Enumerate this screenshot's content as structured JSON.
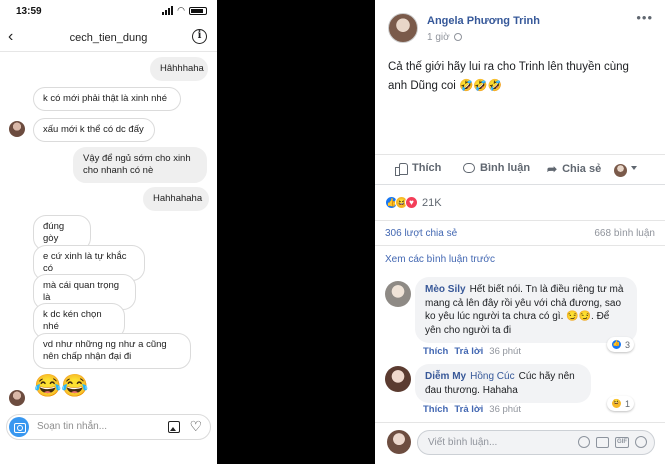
{
  "instagram": {
    "status_time": "13:59",
    "username": "cech_tien_dung",
    "messages": [
      {
        "from": "me",
        "text": "Hâhhhaha"
      },
      {
        "from": "them",
        "text": "k có mới phải thật là xinh nhé"
      },
      {
        "from": "them",
        "text": "xấu mới k thể có dc đấy"
      },
      {
        "from": "me",
        "text": "Vậy để ngủ sớm cho xinh cho nhanh có nè"
      },
      {
        "from": "me",
        "text": "Hahhahaha"
      },
      {
        "from": "them",
        "text": "đúng gòy"
      },
      {
        "from": "them",
        "text": "e cứ xinh là tự khắc có"
      },
      {
        "from": "them",
        "text": "mà cái quan trọng là"
      },
      {
        "from": "them",
        "text": "k dc kén chọn nhé"
      },
      {
        "from": "them",
        "text": "vd như những ng như a cũng nên chấp nhận đại đi"
      }
    ],
    "emoji_reply": "😂😂",
    "input_placeholder": "Soạn tin nhắn...",
    "heart_icon": "♡"
  },
  "facebook": {
    "author": "Angela Phương Trinh",
    "time": "1 giờ",
    "more": "•••",
    "post_text": "Cả thế giới hãy lui ra cho Trinh lên thuyền cùng anh Dũng coi 🤣🤣🤣",
    "actions": {
      "like": "Thích",
      "comment": "Bình luận",
      "share": "Chia sẻ"
    },
    "reactions_count": "21K",
    "shares": "306 lượt chia sẻ",
    "comments_count": "668 bình luận",
    "view_previous": "Xem các bình luận trước",
    "comments": [
      {
        "name": "Mèo Sily",
        "text": "Hết biết nói. Tn là điều riêng tư mà mang cả lên đây rồi yêu với chả đương, sao ko yêu lúc người ta chưa có gì. 😏😏. Để yên cho người ta đi",
        "like": "Thích",
        "reply": "Trả lời",
        "time": "36 phút",
        "badge_count": "3"
      },
      {
        "name": "Diễm My",
        "name_rest": "Hồng Cúc",
        "text": "Cúc hãy nên đau thương. Hahaha",
        "like": "Thích",
        "reply": "Trả lời",
        "time": "36 phút",
        "badge_count": "1"
      }
    ],
    "write_placeholder": "Viết bình luận...",
    "write_icons": [
      "smile-icon",
      "camera-icon",
      "gif-icon",
      "sticker-icon"
    ],
    "gif_label": "GIF",
    "colors": {
      "link": "#365899",
      "fb_blue": "#4267b2",
      "meta_gray": "#90949c",
      "ig_blue": "#3897f0"
    }
  }
}
